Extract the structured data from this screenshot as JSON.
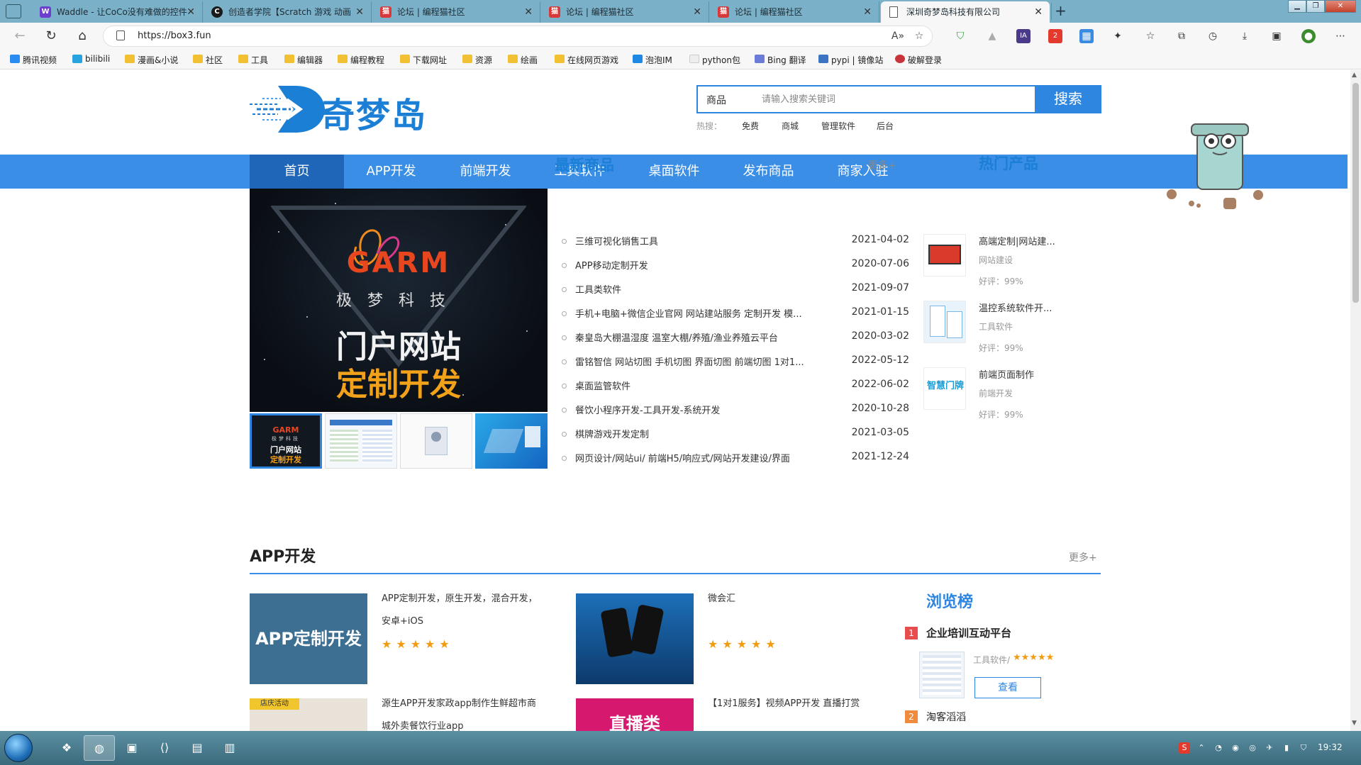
{
  "browser": {
    "tabs": [
      {
        "title": "Waddle - 让CoCo没有难做的控件",
        "icon": "W",
        "color": "#6c3fd1"
      },
      {
        "title": "创造者学院【Scratch 游戏 动画",
        "icon": "C",
        "color": "#1a1a1a"
      },
      {
        "title": "论坛 | 编程猫社区",
        "icon": "猫",
        "color": "#d8383a"
      },
      {
        "title": "论坛 | 编程猫社区",
        "icon": "猫",
        "color": "#d8383a"
      },
      {
        "title": "论坛 | 编程猫社区",
        "icon": "猫",
        "color": "#d8383a"
      },
      {
        "title": "深圳奇梦岛科技有限公司",
        "icon": "page-icon",
        "color": "#ffffff"
      }
    ],
    "url": "https://box3.fun",
    "bookmarks": [
      {
        "label": "腾讯视频",
        "type": "tencent-video-icon"
      },
      {
        "label": "bilibili",
        "type": "bilibili-icon"
      },
      {
        "label": "漫画&小说",
        "type": "folder-icon"
      },
      {
        "label": "社区",
        "type": "folder-icon"
      },
      {
        "label": "工具",
        "type": "folder-icon"
      },
      {
        "label": "编辑器",
        "type": "folder-icon"
      },
      {
        "label": "编程教程",
        "type": "folder-icon"
      },
      {
        "label": "下载网址",
        "type": "folder-icon"
      },
      {
        "label": "资源",
        "type": "folder-icon"
      },
      {
        "label": "绘画",
        "type": "folder-icon"
      },
      {
        "label": "在线网页游戏",
        "type": "folder-icon"
      },
      {
        "label": "泡泡IM",
        "type": "paopao-icon"
      },
      {
        "label": "python包",
        "type": "python-icon"
      },
      {
        "label": "Bing 翻译",
        "type": "bing-icon"
      },
      {
        "label": "pypi | 镜像站",
        "type": "pypi-icon"
      },
      {
        "label": "破解登录",
        "type": "crack-icon"
      }
    ]
  },
  "site": {
    "logo_text": "奇梦岛",
    "search": {
      "category": "商品",
      "placeholder": "请输入搜索关键词",
      "button": "搜索"
    },
    "hot_label": "热搜：",
    "hot_words": [
      "免费",
      "商城",
      "管理软件",
      "后台"
    ],
    "nav": [
      "首页",
      "APP开发",
      "前端开发",
      "工具软件",
      "桌面软件",
      "发布商品",
      "商家入驻"
    ],
    "banner": {
      "brand": "GARM",
      "brand_sub": "极梦科技",
      "line1": "门户网站",
      "line2": "定制开发"
    },
    "thumb_mini": {
      "brand": "GARM",
      "sub": "极梦科技",
      "line1": "门户网站",
      "line2": "定制开发"
    },
    "latest": {
      "title": "最新商品",
      "more": "更多+",
      "items": [
        {
          "text": "三维可视化销售工具",
          "date": "2021-04-02"
        },
        {
          "text": "APP移动定制开发",
          "date": "2020-07-06"
        },
        {
          "text": "工具类软件",
          "date": "2021-09-07"
        },
        {
          "text": "手机+电脑+微信企业官网 网站建站服务 定制开发 模...",
          "date": "2021-01-15"
        },
        {
          "text": "秦皇岛大棚温湿度 温室大棚/养殖/渔业养殖云平台",
          "date": "2020-03-02"
        },
        {
          "text": "雷铭智信 网站切图 手机切图 界面切图 前端切图 1对1...",
          "date": "2022-05-12"
        },
        {
          "text": "桌面监管软件",
          "date": "2022-06-02"
        },
        {
          "text": "餐饮小程序开发-工具开发-系统开发",
          "date": "2020-10-28"
        },
        {
          "text": "棋牌游戏开发定制",
          "date": "2021-03-05"
        },
        {
          "text": "网页设计/网站ui/ 前端H5/响应式/网站开发建设/界面",
          "date": "2021-12-24"
        }
      ]
    },
    "hot_products": {
      "title": "热门产品",
      "items": [
        {
          "title": "高端定制|网站建...",
          "category": "网站建设",
          "rating": "好评：99%"
        },
        {
          "title": "温控系统软件开...",
          "category": "工具软件",
          "rating": "好评：99%"
        },
        {
          "title": "前端页面制作",
          "category": "前端开发",
          "rating": "好评：99%",
          "logo": "智慧门牌"
        }
      ]
    },
    "app_section": {
      "title": "APP开发",
      "more": "更多+",
      "cards": [
        {
          "title": "APP定制开发，原生开发，混合开发，安卓+iOS",
          "img_text": "APP定制开发",
          "stars": "★★★★★"
        },
        {
          "title": "微会汇",
          "img_text": "",
          "stars": "★★★★★"
        },
        {
          "title": "源生APP开发家政app制作生鲜超市商城外卖餐饮行业app",
          "img_text": "店庆活动",
          "stars": ""
        },
        {
          "title": "【1对1服务】视频APP开发 直播打赏",
          "img_text": "直播类",
          "stars": ""
        }
      ]
    },
    "ranking": {
      "title": "浏览榜",
      "items": [
        {
          "num": "1",
          "name": "企业培训互动平台",
          "meta": "工具软件/",
          "stars": "★★★★★",
          "button": "查看"
        },
        {
          "num": "2",
          "name": "淘客滔滔"
        }
      ]
    }
  },
  "taskbar": {
    "time": "19:32",
    "apps": [
      "explorer-icon",
      "edge-icon",
      "pycharm-icon",
      "vscode-icon",
      "app-d-icon",
      "app-icon"
    ]
  }
}
